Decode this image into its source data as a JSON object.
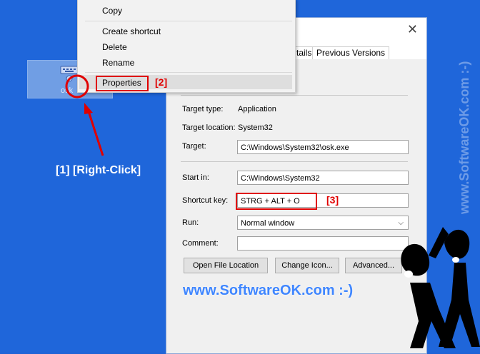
{
  "context_menu": {
    "copy": "Copy",
    "create_shortcut": "Create shortcut",
    "delete": "Delete",
    "rename": "Rename",
    "properties": "Properties"
  },
  "desktop_icon": {
    "label": "osk",
    "icon": "keyboard-icon"
  },
  "window": {
    "close_glyph": "✕",
    "tabs": [
      "tails",
      "Previous Versions"
    ],
    "target_type_label": "Target type:",
    "target_type_value": "Application",
    "target_location_label": "Target location:",
    "target_location_value": "System32",
    "target_label": "Target:",
    "target_value": "C:\\Windows\\System32\\osk.exe",
    "start_in_label": "Start in:",
    "start_in_value": "C:\\Windows\\System32",
    "shortcut_key_label": "Shortcut key:",
    "shortcut_key_value": "STRG + ALT + O",
    "run_label": "Run:",
    "run_value": "Normal window",
    "comment_label": "Comment:",
    "comment_value": "",
    "open_file_location": "Open File Location",
    "change_icon": "Change Icon...",
    "advanced": "Advanced..."
  },
  "annotations": {
    "step1": "[1] [Right-Click]",
    "step2": "[2]",
    "step3": "[3]",
    "accent": "#e00000"
  },
  "watermark": {
    "side": "www.SoftwareOK.com :-)",
    "bottom": "www.SoftwareOK.com :-)"
  }
}
